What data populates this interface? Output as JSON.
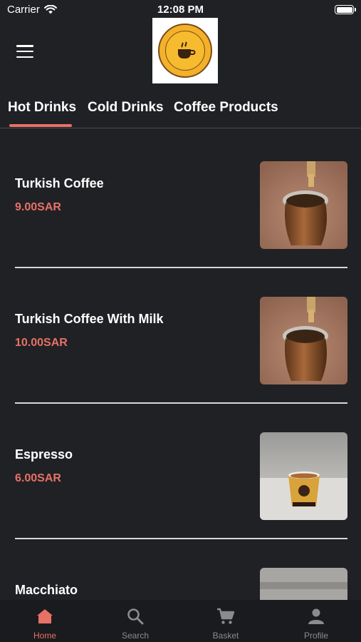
{
  "status_bar": {
    "carrier": "Carrier",
    "time": "12:08 PM"
  },
  "header": {
    "logo_icon": "hot-sands-logo",
    "menu_icon": "hamburger-menu-icon"
  },
  "tabs": [
    {
      "label": "Hot Drinks",
      "active": true
    },
    {
      "label": "Cold Drinks",
      "active": false
    },
    {
      "label": "Coffee Products",
      "active": false
    }
  ],
  "products": [
    {
      "name": "Turkish Coffee",
      "price": "9.00SAR",
      "image": "turkish-coffee-pot"
    },
    {
      "name": "Turkish Coffee With Milk",
      "price": "10.00SAR",
      "image": "turkish-coffee-pot"
    },
    {
      "name": "Espresso",
      "price": "6.00SAR",
      "image": "espresso-cup"
    },
    {
      "name": "Macchiato",
      "price": "",
      "image": "macchiato-cup"
    }
  ],
  "bottom_nav": [
    {
      "label": "Home",
      "icon": "home-icon",
      "active": true
    },
    {
      "label": "Search",
      "icon": "search-icon",
      "active": false
    },
    {
      "label": "Basket",
      "icon": "cart-icon",
      "active": false
    },
    {
      "label": "Profile",
      "icon": "profile-icon",
      "active": false
    }
  ],
  "colors": {
    "background": "#202124",
    "accent": "#e87166",
    "tabbar_bg": "#1a1b1e",
    "inactive": "#8a8b8f"
  }
}
